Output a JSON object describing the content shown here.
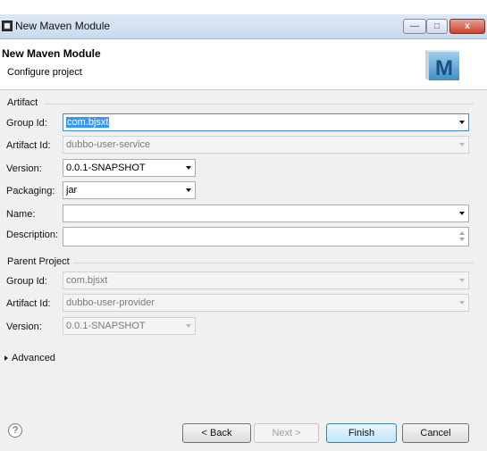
{
  "window": {
    "title": "New Maven Module",
    "minimize_glyph": "—",
    "maximize_glyph": "□",
    "close_glyph": "x"
  },
  "header": {
    "title": "New Maven Module",
    "subtitle": "Configure project",
    "logo_letter": "M"
  },
  "artifact": {
    "section_label": "Artifact",
    "group_id_label": "Group Id:",
    "group_id_value": "com.bjsxt",
    "artifact_id_label": "Artifact Id:",
    "artifact_id_value": "dubbo-user-service",
    "version_label": "Version:",
    "version_value": "0.0.1-SNAPSHOT",
    "packaging_label": "Packaging:",
    "packaging_value": "jar",
    "name_label": "Name:",
    "name_value": "",
    "description_label": "Description:",
    "description_value": ""
  },
  "parent": {
    "section_label": "Parent Project",
    "group_id_label": "Group Id:",
    "group_id_value": "com.bjsxt",
    "artifact_id_label": "Artifact Id:",
    "artifact_id_value": "dubbo-user-provider",
    "version_label": "Version:",
    "version_value": "0.0.1-SNAPSHOT"
  },
  "advanced": {
    "label": "Advanced"
  },
  "footer": {
    "help_glyph": "?",
    "back_label": "< Back",
    "next_label": "Next >",
    "finish_label": "Finish",
    "cancel_label": "Cancel"
  },
  "colors": {
    "selection": "#3399ff",
    "dialog_bg": "#f0f0f0",
    "default_button_border": "#3c7fb1"
  },
  "icons": [
    "app-icon",
    "maven-logo-icon",
    "dropdown-arrow-icon",
    "spinner-icon",
    "expand-arrow-icon",
    "help-icon"
  ]
}
